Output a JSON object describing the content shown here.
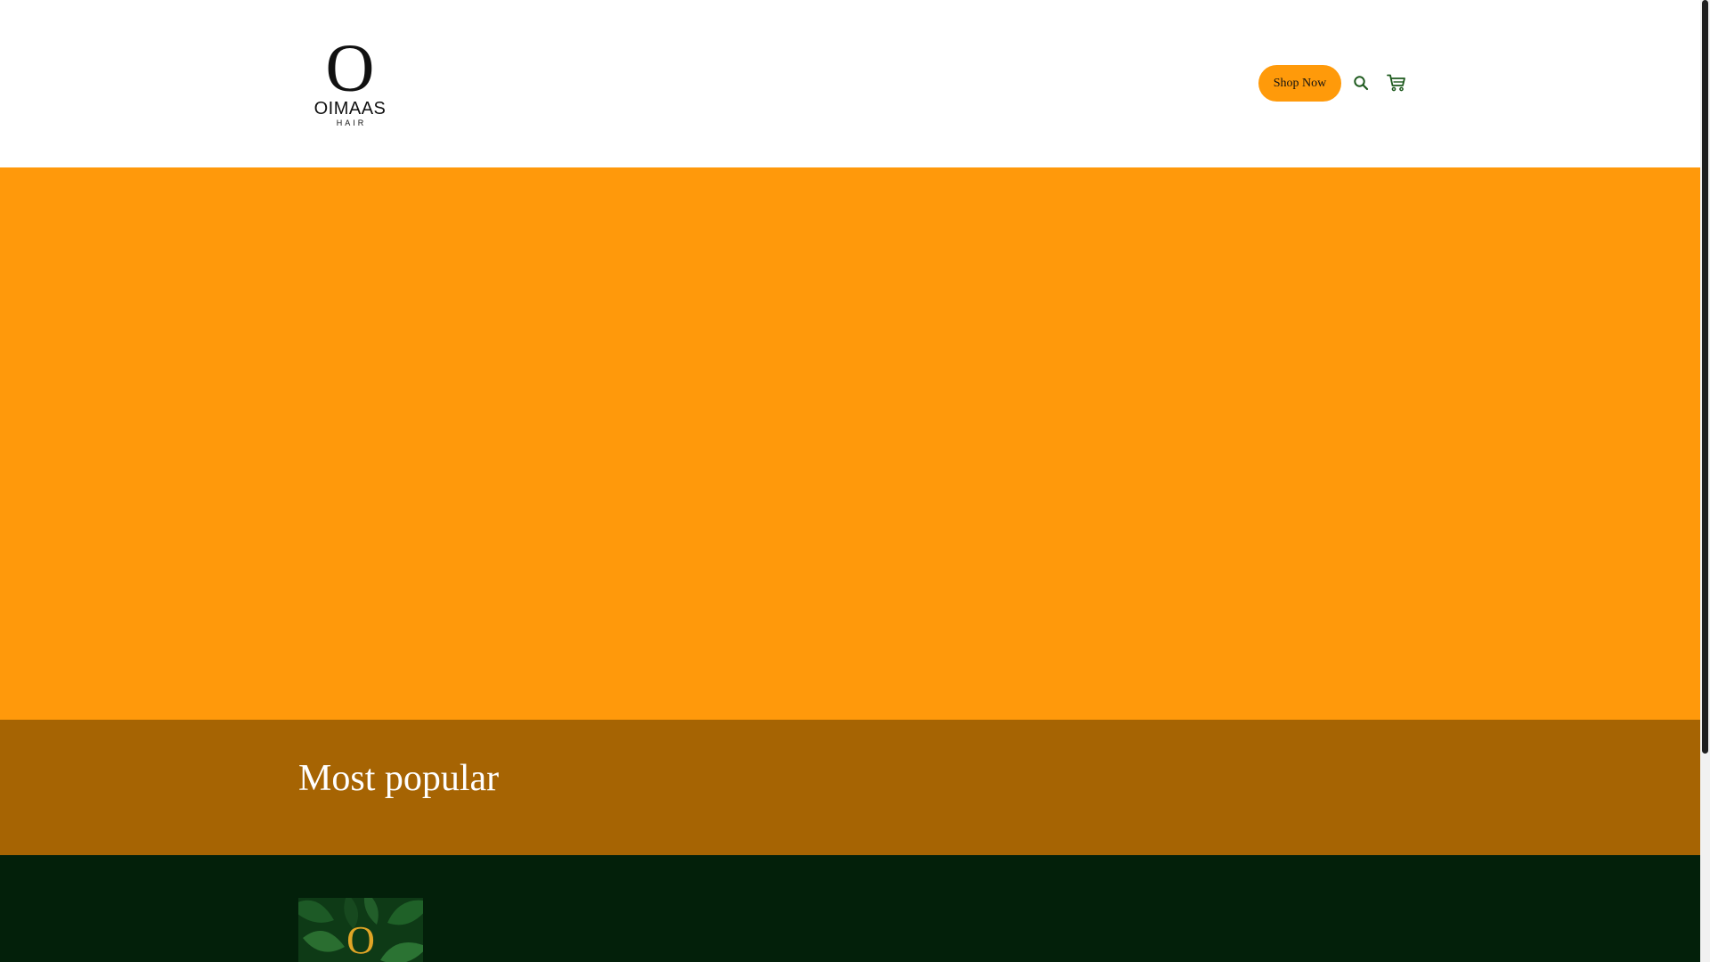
{
  "header": {
    "logo": {
      "mark": "O",
      "name": "OIMAAS",
      "sub": "HAIR"
    },
    "shop_button_label": "Shop Now",
    "icons": [
      "search-icon",
      "cart-icon"
    ]
  },
  "hero": {
    "background_color": "#ff990b"
  },
  "popular": {
    "title": "Most popular",
    "background_color": "#a66403"
  },
  "footer": {
    "background_color": "#03200a",
    "logo_mark": "O"
  },
  "colors": {
    "accent": "#ff9a0a",
    "icon_green": "#1e5a1e"
  }
}
